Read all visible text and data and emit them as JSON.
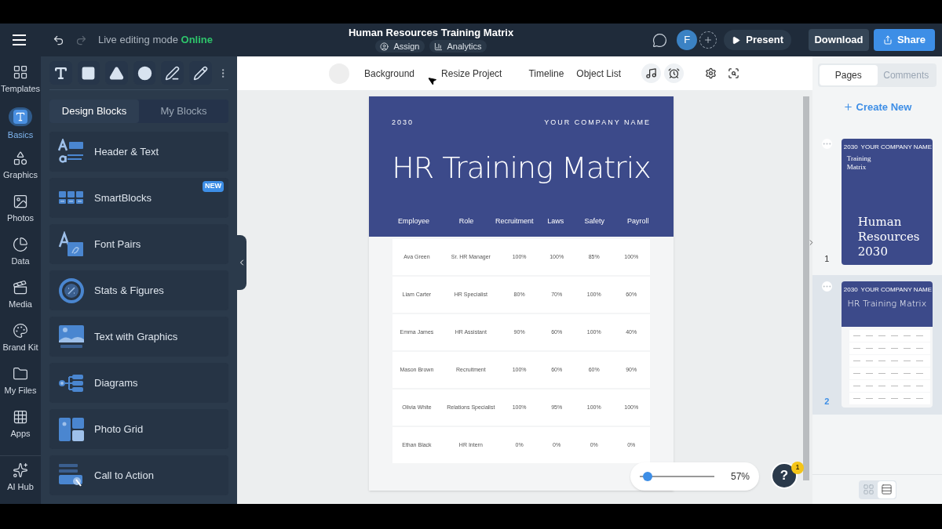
{
  "header": {
    "live_mode_label": "Live editing mode",
    "live_status": "Online",
    "title": "Human Resources Training Matrix",
    "title_links": [
      {
        "kind": "assign",
        "label": "Assign"
      },
      {
        "kind": "analytics",
        "label": "Analytics"
      }
    ],
    "avatar": "F",
    "present": "Present",
    "download": "Download",
    "share": "Share"
  },
  "rail": [
    {
      "kind": "templates",
      "label": "Templates",
      "selected": false
    },
    {
      "kind": "basics",
      "label": "Basics",
      "selected": true
    },
    {
      "kind": "graphics",
      "label": "Graphics",
      "selected": false
    },
    {
      "kind": "photos",
      "label": "Photos",
      "selected": false
    },
    {
      "kind": "data",
      "label": "Data",
      "selected": false
    },
    {
      "kind": "media",
      "label": "Media",
      "selected": false
    },
    {
      "kind": "brand",
      "label": "Brand Kit",
      "selected": false
    },
    {
      "kind": "files",
      "label": "My Files",
      "selected": false
    },
    {
      "kind": "apps",
      "label": "Apps",
      "selected": false
    },
    {
      "kind": "ai",
      "label": "AI Hub",
      "selected": false
    }
  ],
  "tools": [
    {
      "kind": "text"
    },
    {
      "kind": "rectangle"
    },
    {
      "kind": "triangle"
    },
    {
      "kind": "circle"
    },
    {
      "kind": "line"
    },
    {
      "kind": "pen"
    }
  ],
  "panel_tabs": [
    {
      "label": "Design Blocks",
      "selected": true
    },
    {
      "label": "My Blocks",
      "selected": false
    }
  ],
  "blocks": [
    {
      "kind": "header-text",
      "label": "Header & Text"
    },
    {
      "kind": "smartblocks",
      "label": "SmartBlocks",
      "badge": "NEW"
    },
    {
      "kind": "font-pairs",
      "label": "Font Pairs"
    },
    {
      "kind": "stats",
      "label": "Stats & Figures"
    },
    {
      "kind": "text-graphics",
      "label": "Text with Graphics"
    },
    {
      "kind": "diagrams",
      "label": "Diagrams"
    },
    {
      "kind": "photo-grid",
      "label": "Photo Grid"
    },
    {
      "kind": "cta",
      "label": "Call to Action"
    }
  ],
  "canvas_toolbar": {
    "items": [
      "Background",
      "Resize Project",
      "Timeline",
      "Object List"
    ],
    "icons": [
      {
        "kind": "music"
      },
      {
        "kind": "alarm"
      },
      {
        "kind": "settings"
      },
      {
        "kind": "search"
      }
    ]
  },
  "document": {
    "year": "2030",
    "company": "YOUR COMPANY NAME",
    "title": "HR Training Matrix",
    "columns": [
      "Employee",
      "Role",
      "Recruitment",
      "Laws",
      "Safety",
      "Payroll"
    ],
    "rows": [
      [
        "Ava Green",
        "Sr. HR Manager",
        "100%",
        "100%",
        "85%",
        "100%"
      ],
      [
        "Liam Carter",
        "HR Specialist",
        "80%",
        "70%",
        "100%",
        "60%"
      ],
      [
        "Emma James",
        "HR Assistant",
        "90%",
        "60%",
        "100%",
        "40%"
      ],
      [
        "Mason Brown",
        "Recruitment",
        "100%",
        "60%",
        "60%",
        "90%"
      ],
      [
        "Olivia White",
        "Relations Specialist",
        "100%",
        "95%",
        "100%",
        "100%"
      ],
      [
        "Ethan Black",
        "HR Intern",
        "0%",
        "0%",
        "0%",
        "0%"
      ]
    ]
  },
  "zoom": {
    "level": 0.05,
    "reading": "57%"
  },
  "help": {
    "label": "?",
    "badge": "1"
  },
  "right_panel": {
    "tabs": [
      {
        "label": "Pages",
        "selected": true
      },
      {
        "label": "Comments",
        "selected": false
      }
    ],
    "create_new": "Create New",
    "pages": [
      {
        "kind": "cover",
        "number": "1",
        "selected": false,
        "year": "2030",
        "company": "YOUR COMPANY NAME",
        "subtitle": "Training Matrix",
        "title": "Human Resources 2030"
      },
      {
        "kind": "matrix",
        "number": "2",
        "selected": true,
        "year": "2030",
        "company": "YOUR COMPANY NAME",
        "title": "HR Training Matrix"
      }
    ],
    "view_modes": [
      {
        "kind": "grid",
        "selected": false
      },
      {
        "kind": "list",
        "selected": true
      }
    ]
  }
}
